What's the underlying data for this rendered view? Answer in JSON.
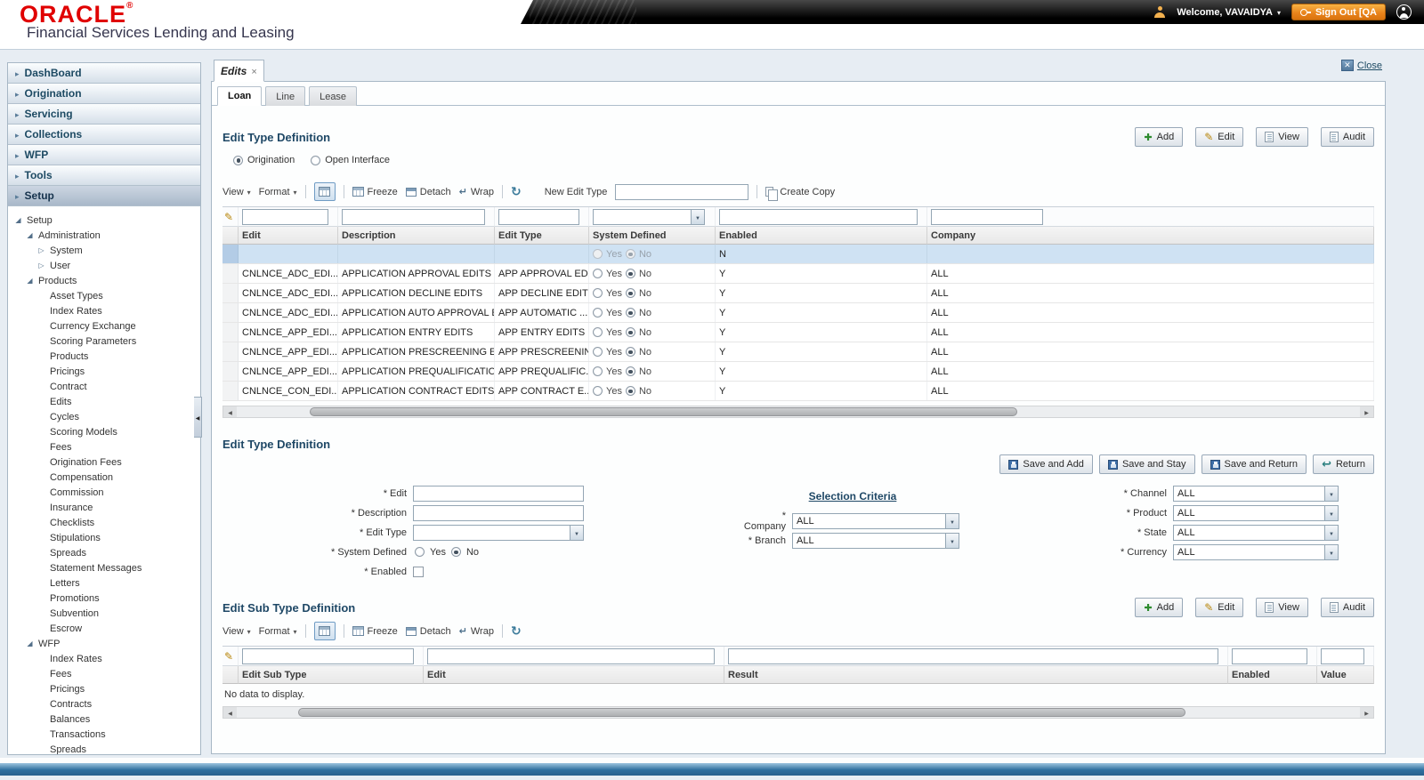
{
  "header": {
    "brand": "ORACLE",
    "registered_mark": "®",
    "subtitle": "Financial Services Lending and Leasing",
    "welcome": "Welcome, VAVAIDYA",
    "sign_out": "Sign Out [QA"
  },
  "sidebar": {
    "menu_items": [
      {
        "label": "DashBoard",
        "selected": false
      },
      {
        "label": "Origination",
        "selected": false
      },
      {
        "label": "Servicing",
        "selected": false
      },
      {
        "label": "Collections",
        "selected": false
      },
      {
        "label": "WFP",
        "selected": false
      },
      {
        "label": "Tools",
        "selected": false
      },
      {
        "label": "Setup",
        "selected": true
      }
    ],
    "tree": [
      {
        "label": "Setup",
        "level": 0,
        "state": "expanded"
      },
      {
        "label": "Administration",
        "level": 1,
        "state": "expanded"
      },
      {
        "label": "System",
        "level": 2,
        "state": "collapsed"
      },
      {
        "label": "User",
        "level": 2,
        "state": "collapsed"
      },
      {
        "label": "Products",
        "level": 1,
        "state": "expanded"
      },
      {
        "label": "Asset Types",
        "level": 2,
        "state": "leaf"
      },
      {
        "label": "Index Rates",
        "level": 2,
        "state": "leaf"
      },
      {
        "label": "Currency Exchange",
        "level": 2,
        "state": "leaf"
      },
      {
        "label": "Scoring Parameters",
        "level": 2,
        "state": "leaf"
      },
      {
        "label": "Products",
        "level": 2,
        "state": "leaf"
      },
      {
        "label": "Pricings",
        "level": 2,
        "state": "leaf"
      },
      {
        "label": "Contract",
        "level": 2,
        "state": "leaf"
      },
      {
        "label": "Edits",
        "level": 2,
        "state": "leaf"
      },
      {
        "label": "Cycles",
        "level": 2,
        "state": "leaf"
      },
      {
        "label": "Scoring Models",
        "level": 2,
        "state": "leaf"
      },
      {
        "label": "Fees",
        "level": 2,
        "state": "leaf"
      },
      {
        "label": "Origination Fees",
        "level": 2,
        "state": "leaf"
      },
      {
        "label": "Compensation",
        "level": 2,
        "state": "leaf"
      },
      {
        "label": "Commission",
        "level": 2,
        "state": "leaf"
      },
      {
        "label": "Insurance",
        "level": 2,
        "state": "leaf"
      },
      {
        "label": "Checklists",
        "level": 2,
        "state": "leaf"
      },
      {
        "label": "Stipulations",
        "level": 2,
        "state": "leaf"
      },
      {
        "label": "Spreads",
        "level": 2,
        "state": "leaf"
      },
      {
        "label": "Statement Messages",
        "level": 2,
        "state": "leaf"
      },
      {
        "label": "Letters",
        "level": 2,
        "state": "leaf"
      },
      {
        "label": "Promotions",
        "level": 2,
        "state": "leaf"
      },
      {
        "label": "Subvention",
        "level": 2,
        "state": "leaf"
      },
      {
        "label": "Escrow",
        "level": 2,
        "state": "leaf"
      },
      {
        "label": "WFP",
        "level": 1,
        "state": "expanded"
      },
      {
        "label": "Index Rates",
        "level": 2,
        "state": "leaf"
      },
      {
        "label": "Fees",
        "level": 2,
        "state": "leaf"
      },
      {
        "label": "Pricings",
        "level": 2,
        "state": "leaf"
      },
      {
        "label": "Contracts",
        "level": 2,
        "state": "leaf"
      },
      {
        "label": "Balances",
        "level": 2,
        "state": "leaf"
      },
      {
        "label": "Transactions",
        "level": 2,
        "state": "leaf"
      },
      {
        "label": "Spreads",
        "level": 2,
        "state": "leaf"
      }
    ]
  },
  "tabs": {
    "document_tab": "Edits",
    "close_label": "Close",
    "subtabs": [
      {
        "label": "Loan",
        "active": true
      },
      {
        "label": "Line",
        "active": false
      },
      {
        "label": "Lease",
        "active": false
      }
    ]
  },
  "edit_type_section": {
    "title": "Edit Type Definition",
    "actions": {
      "add": "Add",
      "edit": "Edit",
      "view": "View",
      "audit": "Audit"
    },
    "radio_options": [
      {
        "label": "Origination",
        "selected": true
      },
      {
        "label": "Open Interface",
        "selected": false
      }
    ],
    "toolbar": {
      "view": "View",
      "format": "Format",
      "freeze": "Freeze",
      "detach": "Detach",
      "wrap": "Wrap",
      "new_edit_type_label": "New Edit Type",
      "create_copy": "Create Copy"
    },
    "table": {
      "columns": [
        "Edit",
        "Description",
        "Edit Type",
        "System Defined",
        "Enabled",
        "Company"
      ],
      "radio_yes": "Yes",
      "radio_no": "No",
      "rows": [
        {
          "edit": "",
          "description": "",
          "edit_type": "",
          "system_defined": "No",
          "enabled": "N",
          "company": "",
          "selected": true,
          "muted": true
        },
        {
          "edit": "CNLNCE_ADC_EDI...",
          "description": "APPLICATION APPROVAL EDITS",
          "edit_type": "APP APPROVAL ED...",
          "system_defined": "No",
          "enabled": "Y",
          "company": "ALL",
          "selected": false,
          "muted": false
        },
        {
          "edit": "CNLNCE_ADC_EDI...",
          "description": "APPLICATION DECLINE EDITS",
          "edit_type": "APP DECLINE EDITS",
          "system_defined": "No",
          "enabled": "Y",
          "company": "ALL",
          "selected": false,
          "muted": false
        },
        {
          "edit": "CNLNCE_ADC_EDI...",
          "description": "APPLICATION AUTO APPROVAL E...",
          "edit_type": "APP AUTOMATIC ...",
          "system_defined": "No",
          "enabled": "Y",
          "company": "ALL",
          "selected": false,
          "muted": false
        },
        {
          "edit": "CNLNCE_APP_EDI...",
          "description": "APPLICATION ENTRY EDITS",
          "edit_type": "APP ENTRY EDITS",
          "system_defined": "No",
          "enabled": "Y",
          "company": "ALL",
          "selected": false,
          "muted": false
        },
        {
          "edit": "CNLNCE_APP_EDI...",
          "description": "APPLICATION PRESCREENING ED...",
          "edit_type": "APP PRESCREENIN...",
          "system_defined": "No",
          "enabled": "Y",
          "company": "ALL",
          "selected": false,
          "muted": false
        },
        {
          "edit": "CNLNCE_APP_EDI...",
          "description": "APPLICATION PREQUALIFICATIO...",
          "edit_type": "APP PREQUALIFIC...",
          "system_defined": "No",
          "enabled": "Y",
          "company": "ALL",
          "selected": false,
          "muted": false
        },
        {
          "edit": "CNLNCE_CON_EDI...",
          "description": "APPLICATION CONTRACT EDITS",
          "edit_type": "APP CONTRACT E...",
          "system_defined": "No",
          "enabled": "Y",
          "company": "ALL",
          "selected": false,
          "muted": false
        }
      ]
    }
  },
  "edit_type_form": {
    "title": "Edit Type Definition",
    "buttons": {
      "save_add": "Save and Add",
      "save_stay": "Save and Stay",
      "save_return": "Save and Return",
      "return": "Return"
    },
    "fields": {
      "edit_label": "* Edit",
      "description_label": "* Description",
      "edit_type_label": "* Edit Type",
      "system_defined_label": "* System Defined",
      "yes_label": "Yes",
      "no_label": "No",
      "enabled_label": "* Enabled",
      "selection_criteria_title": "Selection Criteria",
      "company_label": "* Company",
      "company_value": "ALL",
      "branch_label": "* Branch",
      "branch_value": "ALL",
      "channel_label": "* Channel",
      "channel_value": "ALL",
      "product_label": "* Product",
      "product_value": "ALL",
      "state_label": "* State",
      "state_value": "ALL",
      "currency_label": "* Currency",
      "currency_value": "ALL"
    }
  },
  "edit_subtype_section": {
    "title": "Edit Sub Type Definition",
    "actions": {
      "add": "Add",
      "edit": "Edit",
      "view": "View",
      "audit": "Audit"
    },
    "toolbar": {
      "view": "View",
      "format": "Format",
      "freeze": "Freeze",
      "detach": "Detach",
      "wrap": "Wrap"
    },
    "table": {
      "columns": [
        "Edit Sub Type",
        "Edit",
        "Result",
        "Enabled",
        "Value"
      ],
      "empty_message": "No data to display."
    }
  },
  "colors": {
    "brand_red": "#e00000",
    "accent_orange": "#e8821a",
    "heading_navy": "#1f4866",
    "selected_row": "#cfe2f3"
  }
}
